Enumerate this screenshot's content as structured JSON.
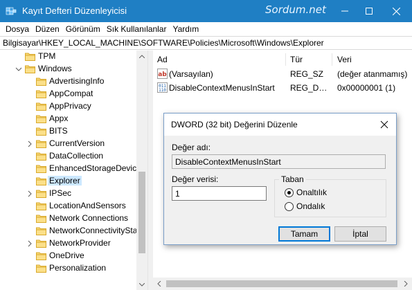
{
  "window": {
    "title": "Kayıt Defteri Düzenleyicisi",
    "watermark": "Sordum.net",
    "accent_color": "#1f7fc4"
  },
  "menu": [
    "Dosya",
    "Düzen",
    "Görünüm",
    "Sık Kullanılanlar",
    "Yardım"
  ],
  "address": "Bilgisayar\\HKEY_LOCAL_MACHINE\\SOFTWARE\\Policies\\Microsoft\\Windows\\Explorer",
  "tree": [
    {
      "label": "TPM",
      "expandable": false,
      "expanded": false,
      "selected": false
    },
    {
      "label": "Windows",
      "expandable": true,
      "expanded": true,
      "selected": false
    },
    {
      "label": "AdvertisingInfo",
      "expandable": false,
      "expanded": false,
      "selected": false
    },
    {
      "label": "AppCompat",
      "expandable": false,
      "expanded": false,
      "selected": false
    },
    {
      "label": "AppPrivacy",
      "expandable": false,
      "expanded": false,
      "selected": false
    },
    {
      "label": "Appx",
      "expandable": false,
      "expanded": false,
      "selected": false
    },
    {
      "label": "BITS",
      "expandable": false,
      "expanded": false,
      "selected": false
    },
    {
      "label": "CurrentVersion",
      "expandable": true,
      "expanded": false,
      "selected": false
    },
    {
      "label": "DataCollection",
      "expandable": false,
      "expanded": false,
      "selected": false
    },
    {
      "label": "EnhancedStorageDevices",
      "expandable": false,
      "expanded": false,
      "selected": false
    },
    {
      "label": "Explorer",
      "expandable": false,
      "expanded": false,
      "selected": true
    },
    {
      "label": "IPSec",
      "expandable": true,
      "expanded": false,
      "selected": false
    },
    {
      "label": "LocationAndSensors",
      "expandable": false,
      "expanded": false,
      "selected": false
    },
    {
      "label": "Network Connections",
      "expandable": false,
      "expanded": false,
      "selected": false
    },
    {
      "label": "NetworkConnectivityStatusIndicator",
      "expandable": false,
      "expanded": false,
      "selected": false
    },
    {
      "label": "NetworkProvider",
      "expandable": true,
      "expanded": false,
      "selected": false
    },
    {
      "label": "OneDrive",
      "expandable": false,
      "expanded": false,
      "selected": false
    },
    {
      "label": "Personalization",
      "expandable": false,
      "expanded": false,
      "selected": false
    }
  ],
  "list": {
    "columns": [
      "Ad",
      "Tür",
      "Veri"
    ],
    "rows": [
      {
        "icon": "string-value-icon",
        "name": "(Varsayılan)",
        "type": "REG_SZ",
        "data": "(değer atanmamış)"
      },
      {
        "icon": "dword-value-icon",
        "name": "DisableContextMenusInStart",
        "type": "REG_DWORD",
        "data": "0x00000001 (1)"
      }
    ]
  },
  "dialog": {
    "title": "DWORD (32 bit) Değerini Düzenle",
    "name_label": "Değer adı:",
    "name_value": "DisableContextMenusInStart",
    "data_label": "Değer verisi:",
    "data_value": "1",
    "base_label": "Taban",
    "base_options": [
      {
        "label": "Onaltılık",
        "checked": true
      },
      {
        "label": "Ondalık",
        "checked": false
      }
    ],
    "ok_label": "Tamam",
    "cancel_label": "İptal"
  }
}
